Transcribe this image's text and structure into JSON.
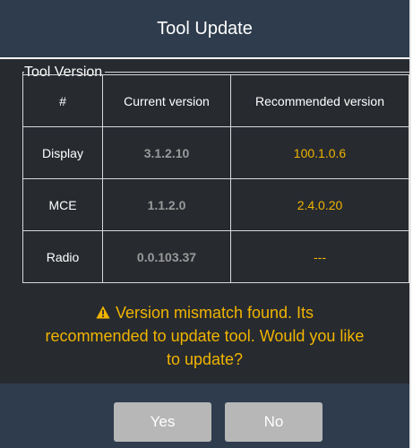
{
  "dialog": {
    "title": "Tool Update"
  },
  "version_group": {
    "legend": "Tool Version",
    "columns": [
      "#",
      "Current version",
      "Recommended version"
    ],
    "rows": [
      {
        "name": "Display",
        "current": "3.1.2.10",
        "recommended": "100.1.0.6"
      },
      {
        "name": "MCE",
        "current": "1.1.2.0",
        "recommended": "2.4.0.20"
      },
      {
        "name": "Radio",
        "current": "0.0.103.37",
        "recommended": "---"
      }
    ]
  },
  "message": {
    "icon": "warning-triangle-icon",
    "line1": "Version mismatch found. Its",
    "line2": "recommended to update tool. Would you like",
    "line3": "to update?"
  },
  "buttons": {
    "yes_label": "Yes",
    "no_label": "No"
  },
  "colors": {
    "title_bar": "#2e3c4d",
    "background": "#272a2f",
    "warning": "#f0b400",
    "muted_text": "#9a9a9a",
    "button": "#b7b7b7"
  }
}
